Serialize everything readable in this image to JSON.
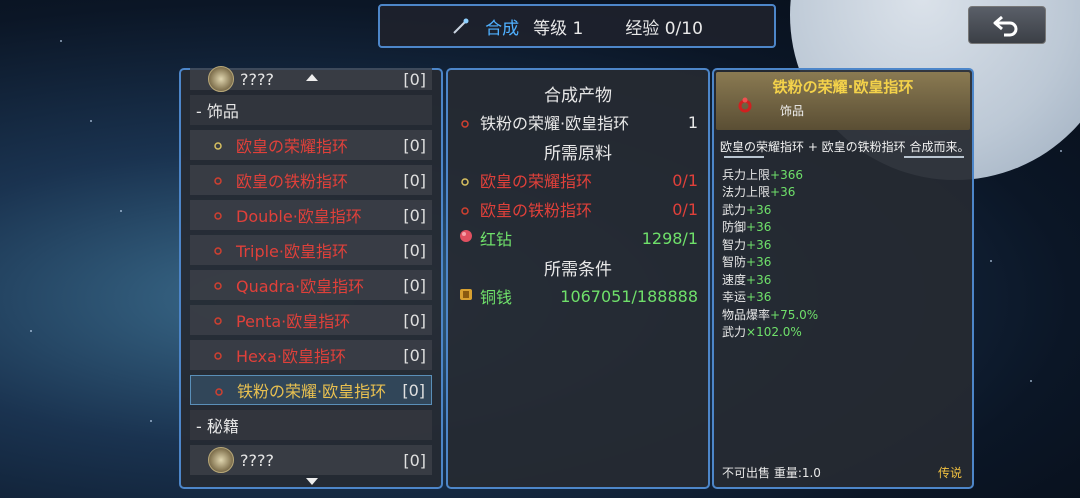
{
  "header": {
    "craft": "合成",
    "level": "等级 1",
    "exp": "经验 0/10"
  },
  "left": {
    "top_partial": {
      "name": "????",
      "count": "[0]"
    },
    "category1": "- 饰品",
    "items": [
      {
        "name": "欧皇の荣耀指环",
        "count": "[0]"
      },
      {
        "name": "欧皇の铁粉指环",
        "count": "[0]"
      },
      {
        "name": "Double·欧皇指环",
        "count": "[0]"
      },
      {
        "name": "Triple·欧皇指环",
        "count": "[0]"
      },
      {
        "name": "Quadra·欧皇指环",
        "count": "[0]"
      },
      {
        "name": "Penta·欧皇指环",
        "count": "[0]"
      },
      {
        "name": "Hexa·欧皇指环",
        "count": "[0]"
      },
      {
        "name": "铁粉の荣耀·欧皇指环",
        "count": "[0]"
      }
    ],
    "category2": "- 秘籍",
    "bottom_item": {
      "name": "????",
      "count": "[0]"
    }
  },
  "middle": {
    "product_title": "合成产物",
    "product": {
      "name": "铁粉の荣耀·欧皇指环",
      "qty": "1"
    },
    "materials_title": "所需原料",
    "materials": [
      {
        "name": "欧皇の荣耀指环",
        "qty": "0/1"
      },
      {
        "name": "欧皇の铁粉指环",
        "qty": "0/1"
      },
      {
        "name": "红钻",
        "qty": "1298/1"
      }
    ],
    "conditions_title": "所需条件",
    "conditions": [
      {
        "name": "铜钱",
        "qty": "1067051/188888"
      }
    ]
  },
  "right": {
    "title": "铁粉の荣耀·欧皇指环",
    "subtitle": "饰品",
    "desc": "欧皇の荣耀指环 + 欧皇の铁粉指环 合成而来。",
    "stats": [
      {
        "label": "兵力上限",
        "value": "+366"
      },
      {
        "label": "法力上限",
        "value": "+36"
      },
      {
        "label": "武力",
        "value": "+36"
      },
      {
        "label": "防御",
        "value": "+36"
      },
      {
        "label": "智力",
        "value": "+36"
      },
      {
        "label": "智防",
        "value": "+36"
      },
      {
        "label": "速度",
        "value": "+36"
      },
      {
        "label": "幸运",
        "value": "+36"
      },
      {
        "label": "物品爆率",
        "value": "+75.0%"
      },
      {
        "label": "武力",
        "value": "×102.0%"
      }
    ],
    "footer_left": "不可出售 重量:1.0",
    "footer_right": "传说"
  }
}
